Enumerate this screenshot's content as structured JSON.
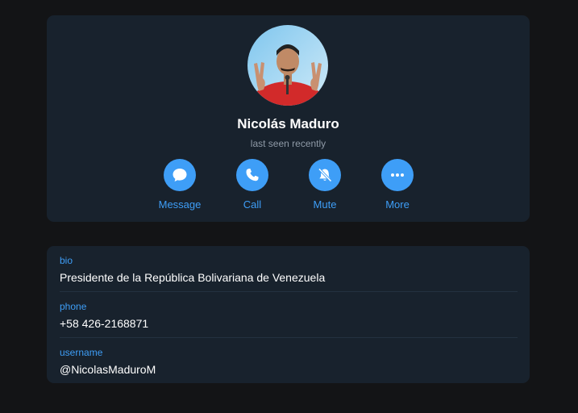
{
  "profile": {
    "name": "Nicolás Maduro",
    "status": "last seen recently"
  },
  "actions": [
    {
      "label": "Message",
      "icon": "chat-bubble-icon"
    },
    {
      "label": "Call",
      "icon": "phone-icon"
    },
    {
      "label": "Mute",
      "icon": "bell-muted-icon"
    },
    {
      "label": "More",
      "icon": "more-dots-icon"
    }
  ],
  "info": {
    "bio_label": "bio",
    "bio_value": "Presidente de la República Bolivariana de Venezuela",
    "phone_label": "phone",
    "phone_value": "+58 426-2168871",
    "username_label": "username",
    "username_value": "@NicolasMaduroM"
  },
  "colors": {
    "background": "#131416",
    "card": "#18222d",
    "accent": "#3e9ef7",
    "text": "#ffffff",
    "muted": "#8f9aa7"
  }
}
